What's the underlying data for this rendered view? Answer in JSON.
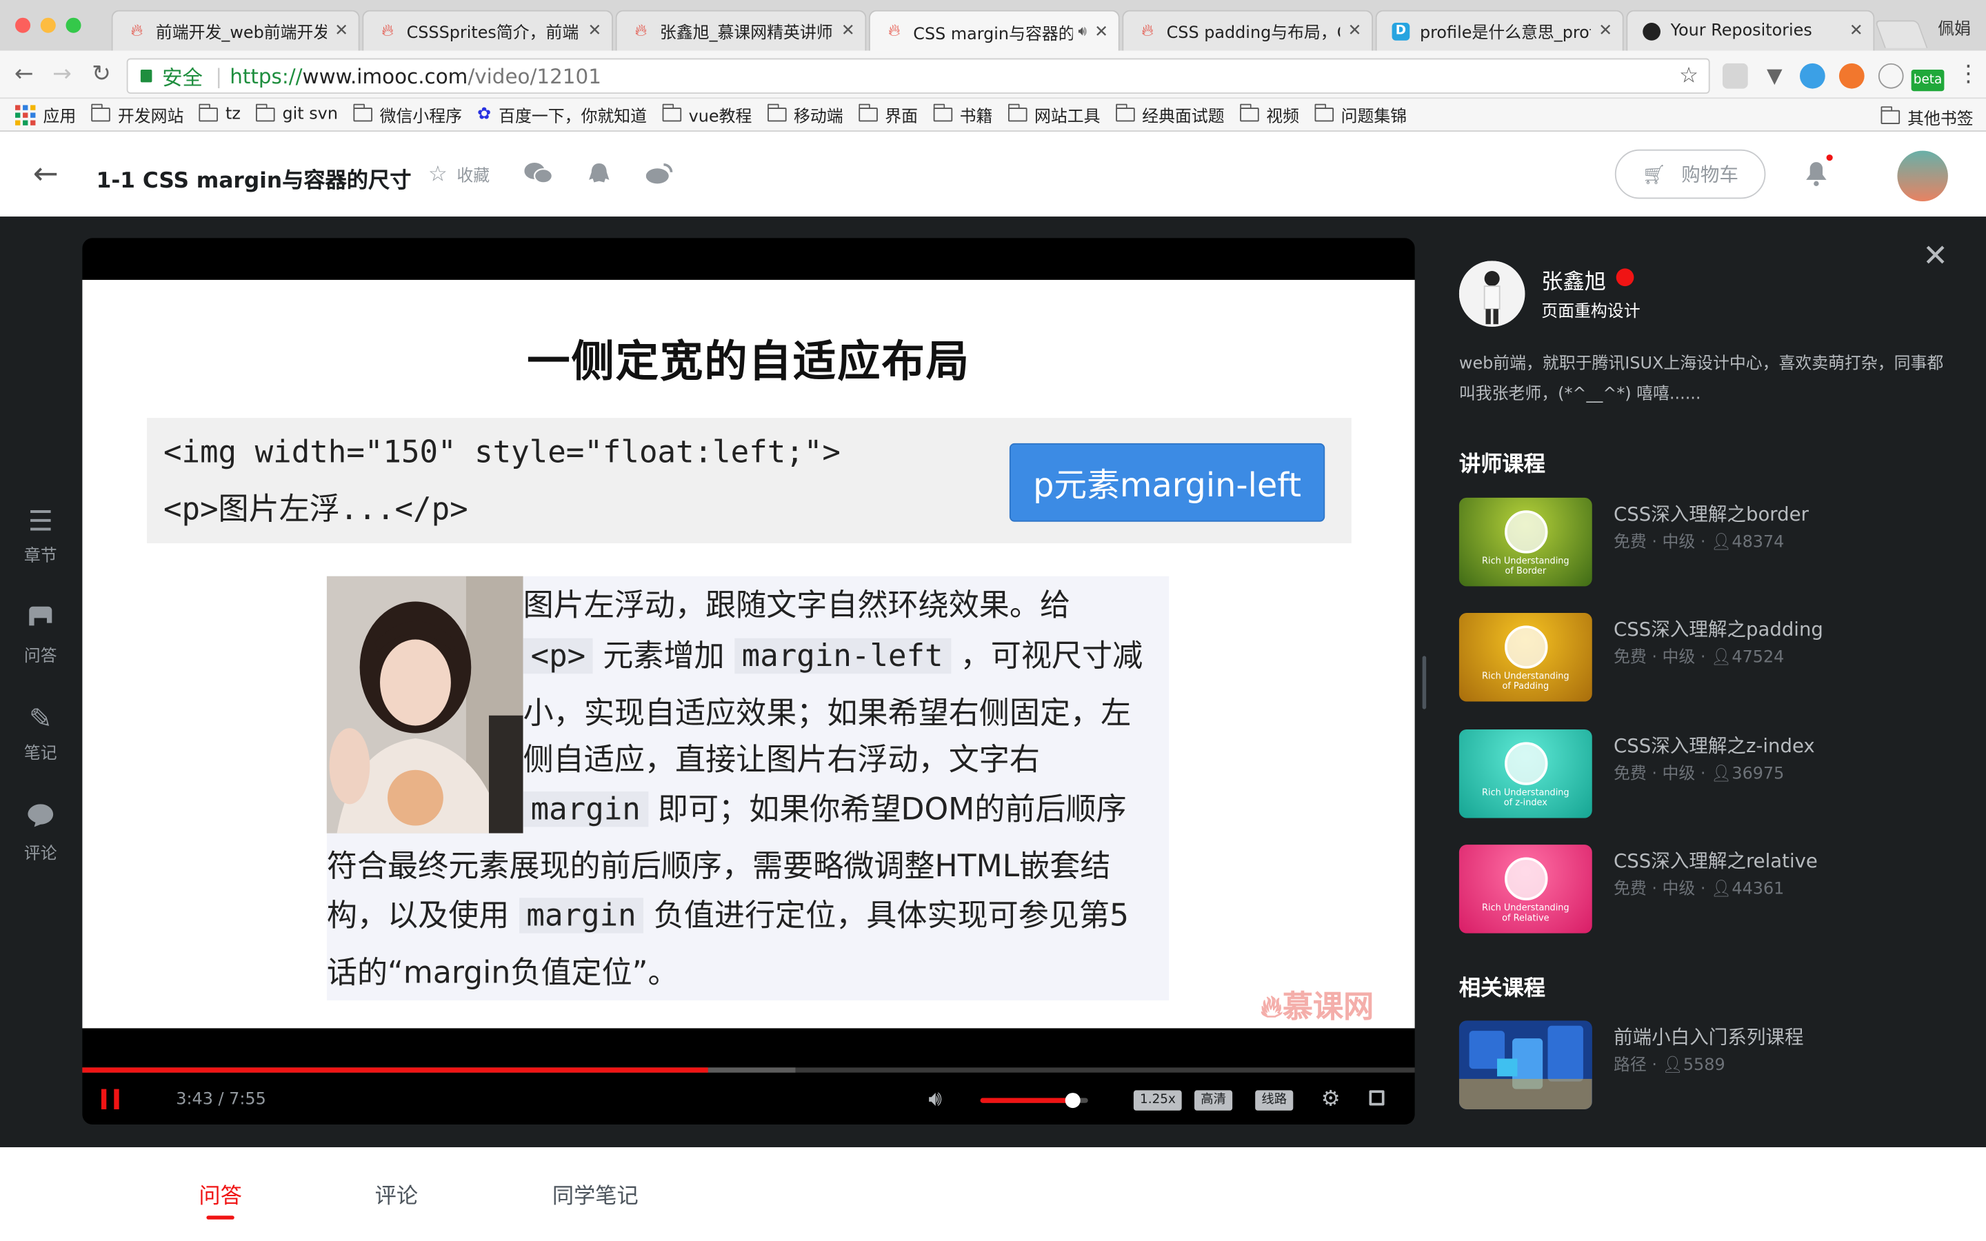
{
  "browser": {
    "user_name": "佩娟",
    "tabs": [
      {
        "title": "前端开发_web前端开发"
      },
      {
        "title": "CSSSprites简介，前端"
      },
      {
        "title": "张鑫旭_慕课网精英讲师"
      },
      {
        "title": "CSS margin与容器的"
      },
      {
        "title": "CSS padding与布局，C"
      },
      {
        "title": "profile是什么意思_profi"
      },
      {
        "title": "Your Repositories"
      }
    ],
    "secure_label": "安全",
    "url_prefix": "https://",
    "url_host": "www.imooc.com",
    "url_path": "/video/12101",
    "ext_beta": "beta",
    "bookmarks": {
      "apps": "应用",
      "items": [
        "开发网站",
        "tz",
        "git svn",
        "微信小程序",
        "百度一下，你就知道",
        "vue教程",
        "移动端",
        "界面",
        "书籍",
        "网站工具",
        "经典面试题",
        "视频",
        "问题集锦"
      ],
      "other": "其他书签"
    }
  },
  "header": {
    "course_title": "1-1 CSS margin与容器的尺寸",
    "collect_label": "收藏",
    "cart_label": "购物车"
  },
  "sidebar": {
    "items": [
      "章节",
      "问答",
      "笔记",
      "评论"
    ]
  },
  "slide": {
    "title": "一侧定宽的自适应布局",
    "code_line1": "<img width=\"150\" style=\"float:left;\">",
    "code_line2": "<p>图片左浮...</p>",
    "button_label": "p元素margin-left",
    "para": {
      "l1": "图片左浮动，跟随文字自然环绕效果。给",
      "l2_code": "<p>",
      "l2_text": "元素增加",
      "l2_code2": "margin-left",
      "l2_tail": "，可视尺寸减",
      "l3": "小，实现自适应效果；如果希望右侧固定，左",
      "l4": "侧自适应，直接让图片右浮动，文字右",
      "l5_code": "margin",
      "l5_text": "即可；如果你希望DOM的前后顺序",
      "l6": "符合最终元素展现的前后顺序，需要略微调整HTML嵌套结",
      "l7_head": "构，以及使用",
      "l7_code": "margin",
      "l7_tail": "负值进行定位，具体实现可参见第5",
      "l8": "话的“margin负值定位”。"
    },
    "watermark": "慕课网"
  },
  "player": {
    "time": "3:43 / 7:55",
    "progress": 0.47,
    "buffered": 0.535,
    "volume": 0.86,
    "speed": "1.25x",
    "quality": "高清",
    "line": "线路"
  },
  "teacher": {
    "name": "张鑫旭",
    "title": "页面重构设计",
    "desc": "web前端，就职于腾讯ISUX上海设计中心，喜欢卖萌打杂，同事都叫我张老师，(*^__^*) 嘻嘻......",
    "courses_heading": "讲师课程",
    "courses": [
      {
        "name": "CSS深入理解之border",
        "meta": "免费 · 中级 · ",
        "count": "48374",
        "cap1": "Rich Understanding",
        "cap2": "of Border",
        "color1": "#b5d13a",
        "color2": "#3f6b16"
      },
      {
        "name": "CSS深入理解之padding",
        "meta": "免费 · 中级 · ",
        "count": "47524",
        "cap1": "Rich Understanding",
        "cap2": "of Padding",
        "color1": "#f5c222",
        "color2": "#a86d0c"
      },
      {
        "name": "CSS深入理解之z-index",
        "meta": "免费 · 中级 · ",
        "count": "36975",
        "cap1": "Rich Understanding",
        "cap2": "of z-index",
        "color1": "#5ee9d5",
        "color2": "#16a593"
      },
      {
        "name": "CSS深入理解之relative",
        "meta": "免费 · 中级 · ",
        "count": "44361",
        "cap1": "Rich Understanding",
        "cap2": "of Relative",
        "color1": "#ff6fa5",
        "color2": "#d81d66"
      }
    ],
    "related_heading": "相关课程",
    "related": {
      "name": "前端小白入门系列课程",
      "meta": "路径 · ",
      "count": "5589"
    }
  },
  "bottom_tabs": [
    "问答",
    "评论",
    "同学笔记"
  ]
}
